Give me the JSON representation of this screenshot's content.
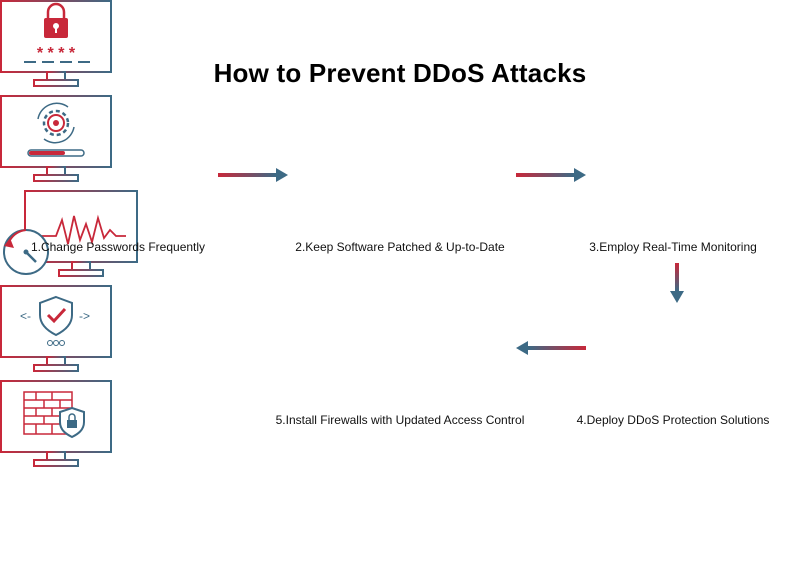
{
  "title": "How to Prevent DDoS Attacks",
  "colors": {
    "red": "#c8283a",
    "blue": "#3d6a85"
  },
  "steps": [
    {
      "label": "1.Change Passwords Frequently",
      "icon": "padlock-password-icon"
    },
    {
      "label": "2.Keep Software Patched & Up-to-Date",
      "icon": "gear-update-icon"
    },
    {
      "label": "3.Employ Real-Time Monitoring",
      "icon": "monitoring-gauge-icon"
    },
    {
      "label": "4.Deploy DDoS Protection Solutions",
      "icon": "shield-check-icon"
    },
    {
      "label": "5.Install Firewalls with Updated Access Control",
      "icon": "firewall-shield-icon"
    }
  ],
  "password_mask": "* * * *"
}
